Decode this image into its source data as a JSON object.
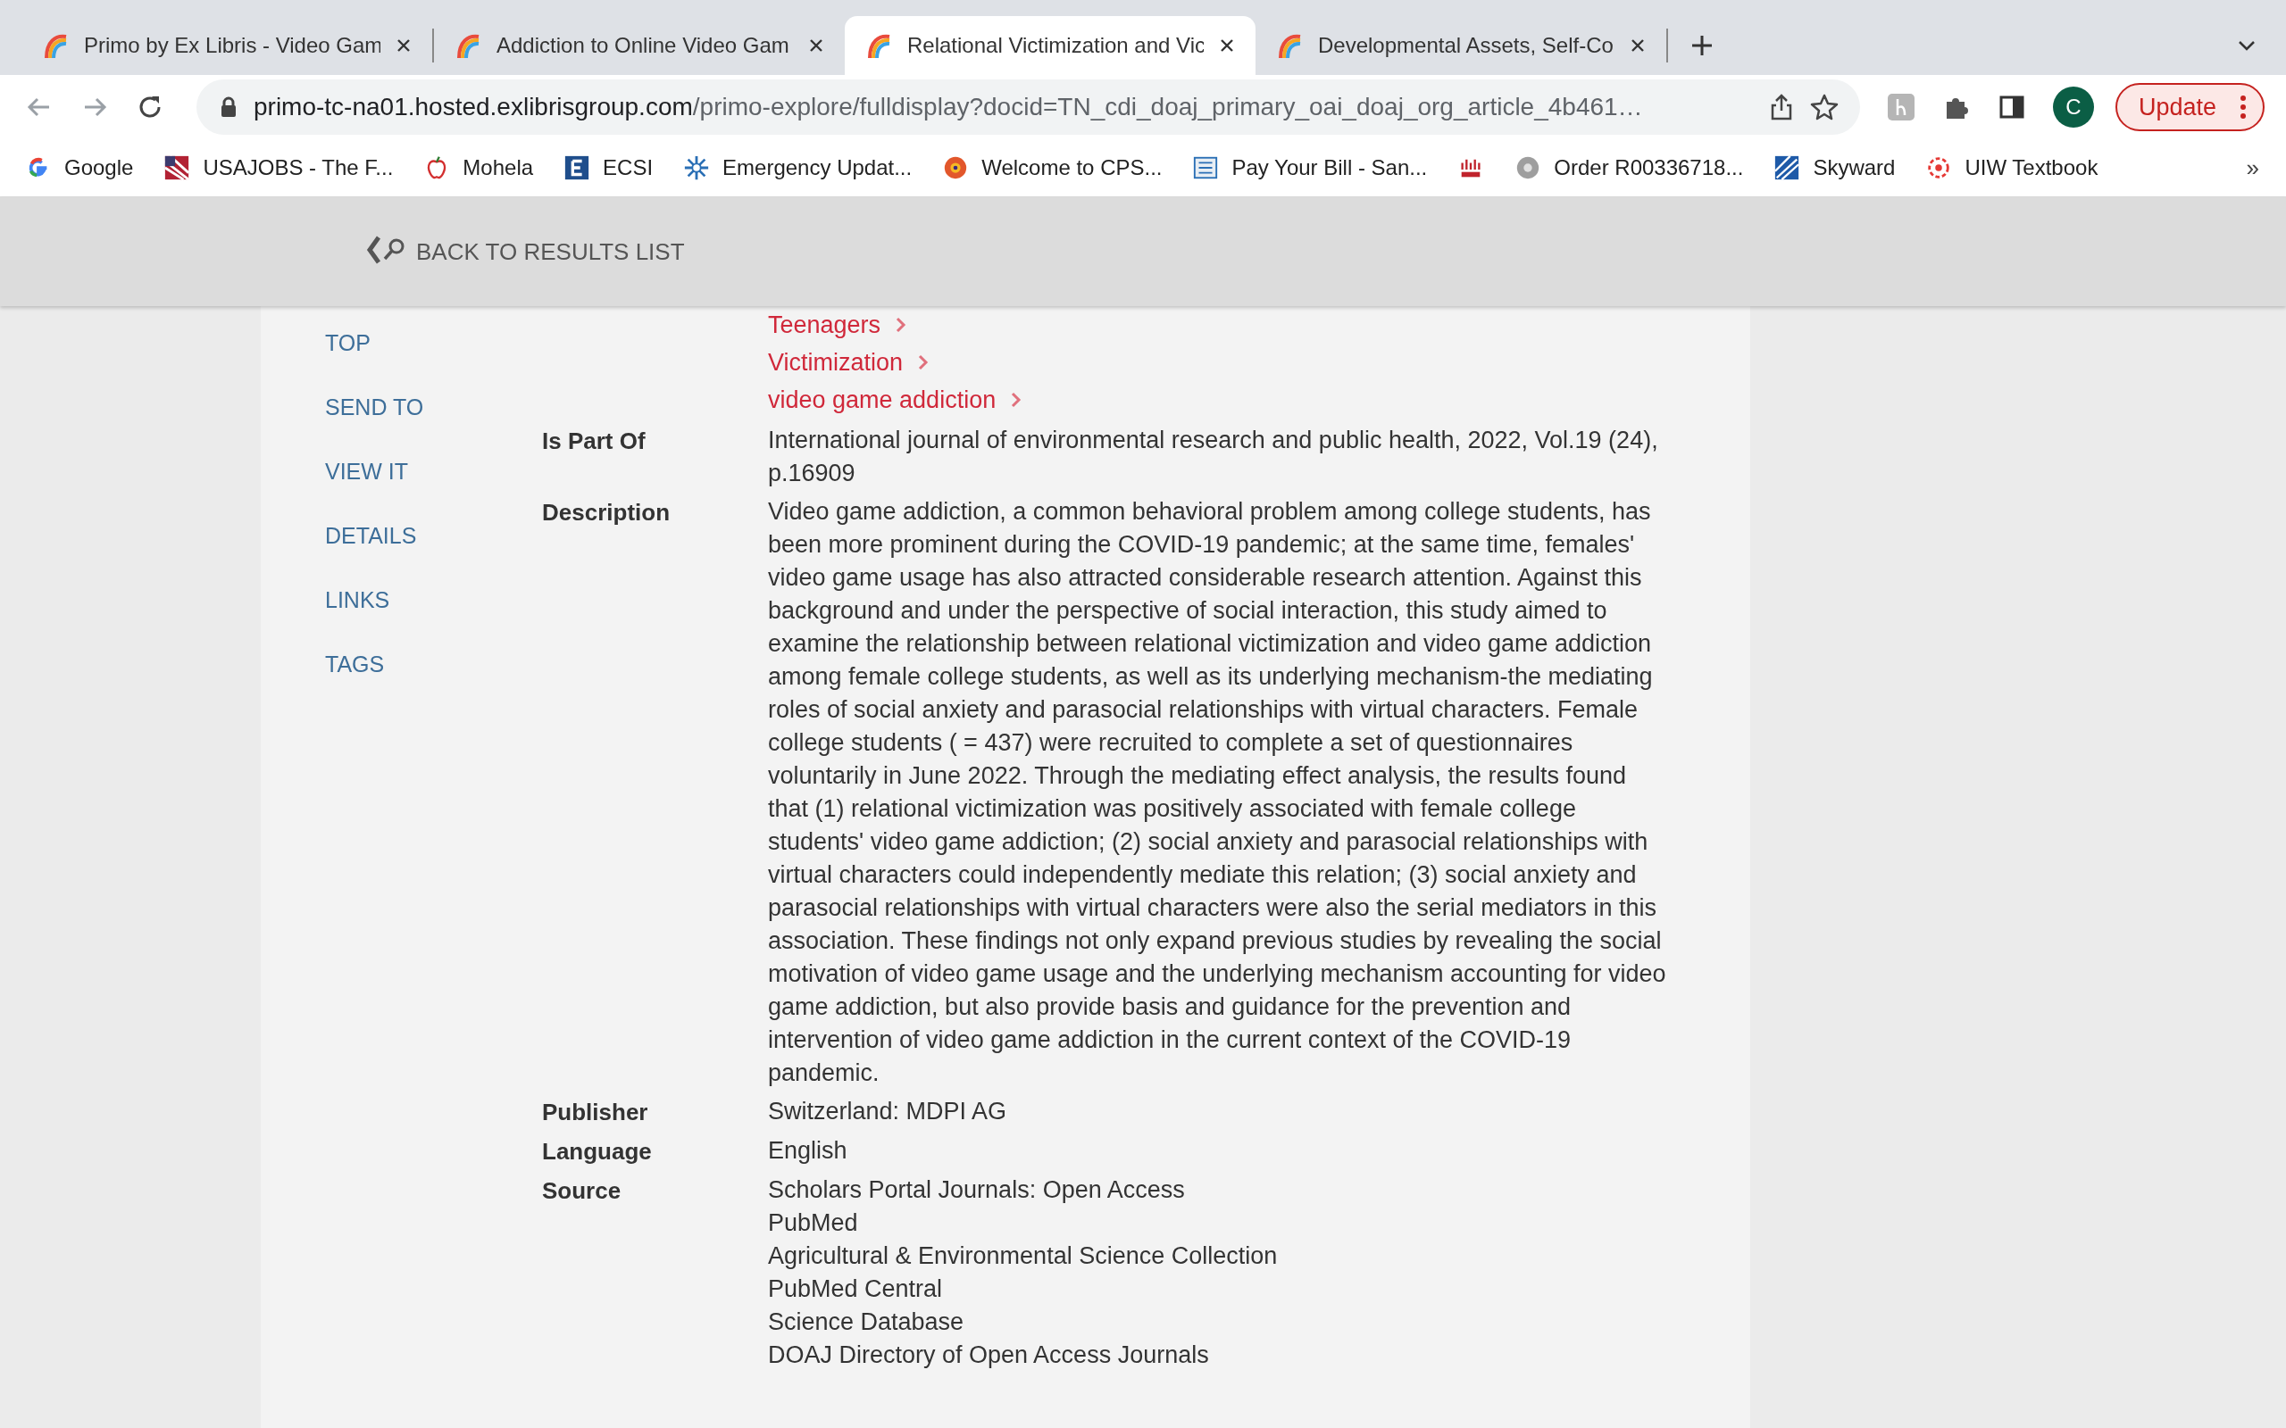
{
  "tabs": [
    {
      "title": "Primo by Ex Libris - Video Gam",
      "selected": false
    },
    {
      "title": "Addiction to Online Video Gam",
      "selected": false
    },
    {
      "title": "Relational Victimization and Vic",
      "selected": true
    },
    {
      "title": "Developmental Assets, Self-Co",
      "selected": false
    }
  ],
  "address_bar": {
    "host": "primo-tc-na01.hosted.exlibrisgroup.com",
    "path": "/primo-explore/fulldisplay?docid=TN_cdi_doaj_primary_oai_doaj_org_article_4b461…"
  },
  "profile": {
    "initial": "C"
  },
  "update_button": {
    "label": "Update"
  },
  "bookmarks": [
    {
      "label": "Google",
      "kind": "google"
    },
    {
      "label": "USAJOBS - The F...",
      "kind": "flag"
    },
    {
      "label": "Mohela",
      "kind": "apple"
    },
    {
      "label": "ECSI",
      "kind": "square"
    },
    {
      "label": "Emergency Updat...",
      "kind": "star"
    },
    {
      "label": "Welcome to CPS...",
      "kind": "gear"
    },
    {
      "label": "Pay Your Bill - San...",
      "kind": "building"
    },
    {
      "kind": "bars"
    },
    {
      "label": "Order R00336718...",
      "kind": "disc"
    },
    {
      "label": "Skyward",
      "kind": "stripes"
    },
    {
      "label": "UIW Textbook",
      "kind": "ring"
    }
  ],
  "bookmarks_overflow": "»",
  "back_link": "BACK TO RESULTS LIST",
  "section_nav": [
    "TOP",
    "SEND TO",
    "VIEW IT",
    "DETAILS",
    "LINKS",
    "TAGS"
  ],
  "subjects": [
    "Teenagers",
    "Victimization",
    "video game addiction"
  ],
  "details": [
    {
      "label": "Is Part Of",
      "lines": [
        "International journal of environmental research and public health, 2022, Vol.19 (24), p.16909"
      ]
    },
    {
      "label": "Description",
      "lines": [
        "Video game addiction, a common behavioral problem among college students, has been more prominent during the COVID-19 pandemic; at the same time, females' video game usage has also attracted considerable research attention. Against this background and under the perspective of social interaction, this study aimed to examine the relationship between relational victimization and video game addiction among female college students, as well as its underlying mechanism-the mediating roles of social anxiety and parasocial relationships with virtual characters. Female college students ( = 437) were recruited to complete a set of questionnaires voluntarily in June 2022. Through the mediating effect analysis, the results found that (1) relational victimization was positively associated with female college students' video game addiction; (2) social anxiety and parasocial relationships with virtual characters could independently mediate this relation; (3) social anxiety and parasocial relationships with virtual characters were also the serial mediators in this association. These findings not only expand previous studies by revealing the social motivation of video game usage and the underlying mechanism accounting for video game addiction, but also provide basis and guidance for the prevention and intervention of video game addiction in the current context of the COVID-19 pandemic."
      ]
    },
    {
      "label": "Publisher",
      "lines": [
        "Switzerland: MDPI AG"
      ]
    },
    {
      "label": "Language",
      "lines": [
        "English"
      ]
    },
    {
      "label": "Source",
      "lines": [
        "Scholars Portal Journals: Open Access",
        "PubMed",
        "Agricultural & Environmental Science Collection",
        "PubMed Central",
        "Science Database",
        "DOAJ Directory of Open Access Journals"
      ]
    }
  ]
}
